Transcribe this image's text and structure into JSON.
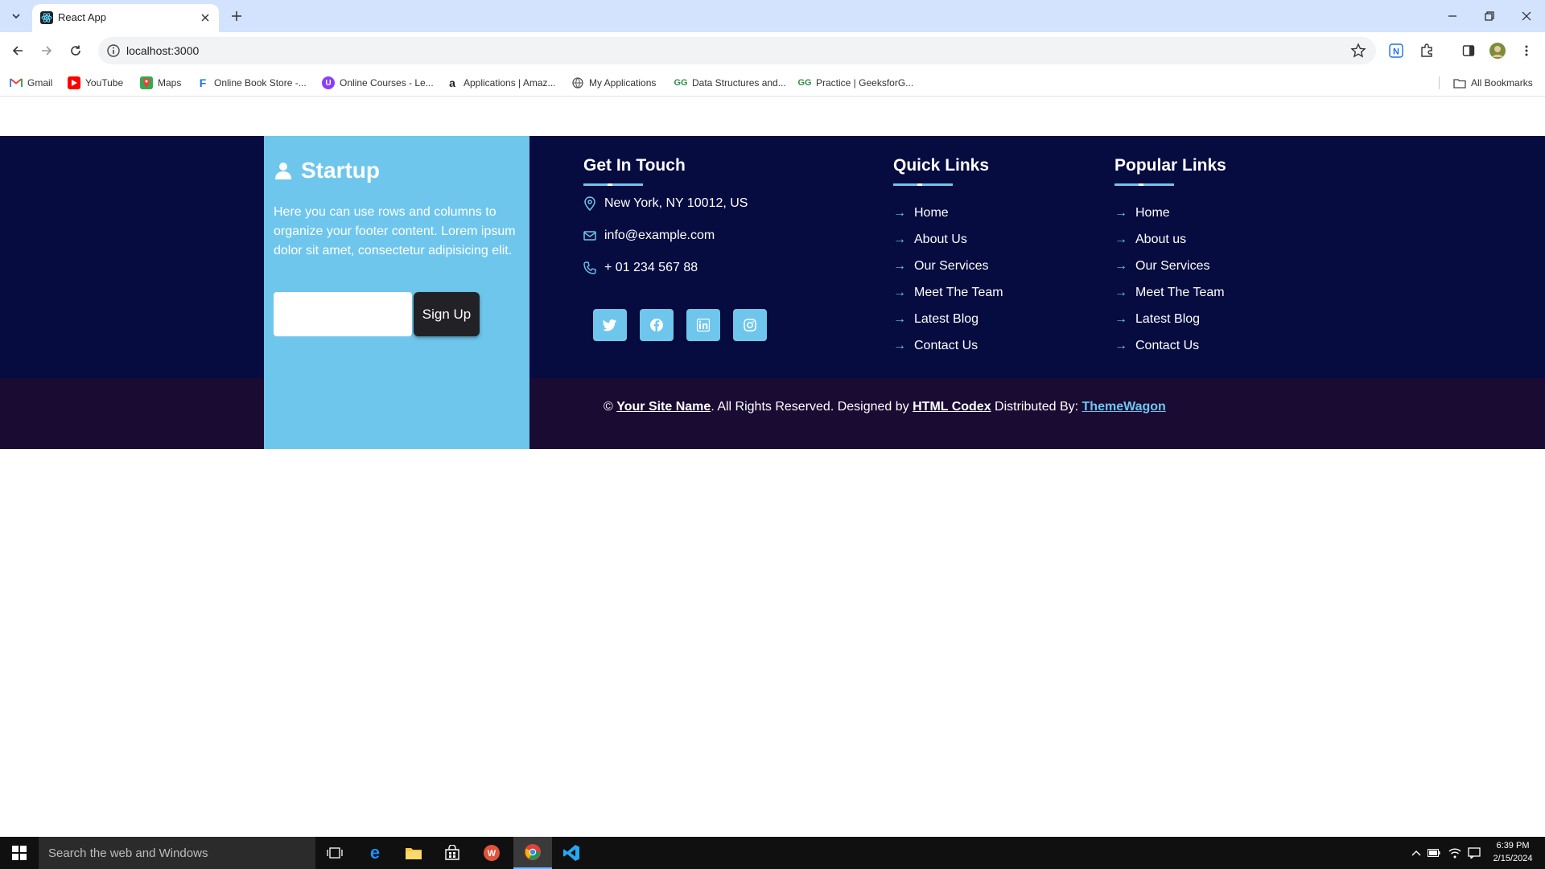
{
  "browser": {
    "tab_title": "React App",
    "url": "localhost:3000",
    "bookmarks": [
      {
        "label": "Gmail",
        "icon": "gmail-icon",
        "color": "#ea4335"
      },
      {
        "label": "YouTube",
        "icon": "youtube-icon",
        "color": "#ff0000"
      },
      {
        "label": "Maps",
        "icon": "maps-icon",
        "color": "#34a853"
      },
      {
        "label": "Online Book Store -...",
        "icon": "bookstore-icon",
        "color": "#1a73e8"
      },
      {
        "label": "Online Courses - Le...",
        "icon": "courses-icon",
        "color": "#8b3dff"
      },
      {
        "label": "Applications | Amaz...",
        "icon": "amazon-icon",
        "color": "#222222"
      },
      {
        "label": "My Applications",
        "icon": "globe-icon",
        "color": "#555555"
      },
      {
        "label": "Data Structures and...",
        "icon": "geeksforgeeks-icon",
        "color": "#2f8d46"
      },
      {
        "label": "Practice | GeeksforG...",
        "icon": "geeksforgeeks-icon",
        "color": "#2f8d46"
      }
    ],
    "all_bookmarks": "All Bookmarks"
  },
  "footer": {
    "brand": "Startup",
    "about_text": "Here you can use rows and columns to organize your footer content. Lorem ipsum dolor sit amet, consectetur adipisicing elit.",
    "email_value": "",
    "signup_label": "Sign Up",
    "contact": {
      "title": "Get In Touch",
      "address": "New York, NY 10012, US",
      "email": "info@example.com",
      "phone": "+ 01 234 567 88"
    },
    "social": [
      "twitter-icon",
      "facebook-icon",
      "linkedin-icon",
      "instagram-icon"
    ],
    "quick_links": {
      "title": "Quick Links",
      "items": [
        "Home",
        "About Us",
        "Our Services",
        "Meet The Team",
        "Latest Blog",
        "Contact Us"
      ]
    },
    "popular_links": {
      "title": "Popular Links",
      "items": [
        "Home",
        "About us",
        "Our Services",
        "Meet The Team",
        "Latest Blog",
        "Contact Us"
      ]
    },
    "copyright": {
      "prefix": "© ",
      "site_name": "Your Site Name",
      "middle": ". All Rights Reserved. Designed by ",
      "designer": "HTML Codex",
      "distributed": " Distributed By: ",
      "distributor": "ThemeWagon"
    }
  },
  "taskbar": {
    "search_placeholder": "Search the web and Windows",
    "time": "6:39 PM",
    "date": "2/15/2024"
  },
  "colors": {
    "footer_bg": "#060b40",
    "bottom_bg": "#1a0b33",
    "accent": "#6ec6ed",
    "signup_bg": "#222226"
  }
}
